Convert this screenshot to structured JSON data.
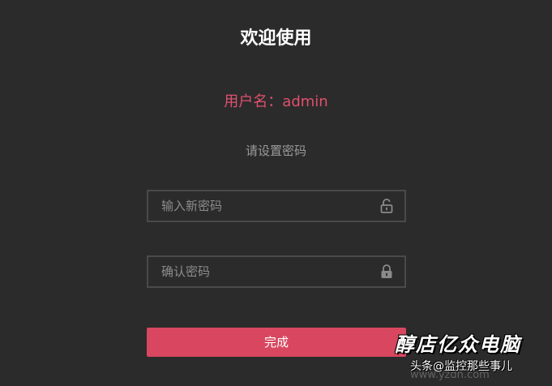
{
  "header": {
    "title": "欢迎使用"
  },
  "account": {
    "username_label": "用户名：admin"
  },
  "form": {
    "subtitle": "请设置密码",
    "new_password": {
      "placeholder": "输入新密码",
      "value": "",
      "lock_icon": "lock-open-icon"
    },
    "confirm_password": {
      "placeholder": "确认密码",
      "value": "",
      "lock_icon": "lock-closed-icon"
    },
    "submit_label": "完成"
  },
  "watermark": {
    "shop_name": "醇店亿众电脑",
    "toutiao": "头条@监控那些事儿",
    "url": "www.yzdn.com"
  },
  "colors": {
    "background": "#2b2b2b",
    "accent": "#d8475f",
    "username": "#e0506e",
    "border": "#4a4a4a"
  }
}
